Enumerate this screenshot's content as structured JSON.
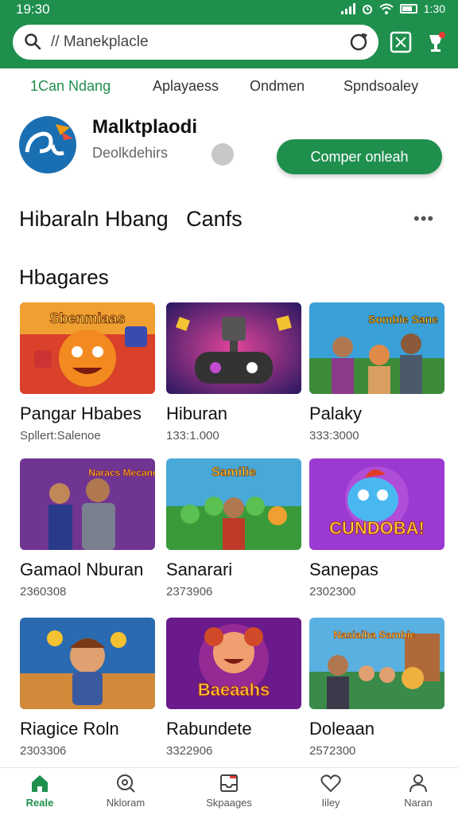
{
  "status_bar": {
    "time": "19:30",
    "right_text": "1:30"
  },
  "search": {
    "value": "// Manekplacle",
    "placeholder": ""
  },
  "tabs": [
    {
      "label": "1Can Ndang",
      "active": true
    },
    {
      "label": "Aplayaess",
      "active": false
    },
    {
      "label": "Ondmen",
      "active": false
    },
    {
      "label": "Spndsoaley",
      "active": false
    }
  ],
  "app": {
    "name": "Malktplaodi",
    "subtitle": "Deolkdehirs",
    "button_label": "Comper onleah"
  },
  "section_title": "Hibaraln Hbang   Canfs",
  "subsection_title": "Hbagares",
  "cards": [
    {
      "name": "Pangar Hbabes",
      "meta": "Spllert:Salenoe",
      "banner": "Sbenmiaas"
    },
    {
      "name": "Hiburan",
      "meta": "133:1.000",
      "banner": ""
    },
    {
      "name": "Palaky",
      "meta": "333:3000",
      "banner": "Sombie Sane"
    },
    {
      "name": "Gamaol Nburan",
      "meta": "2360308",
      "banner": "Naracs Mecaneaiis"
    },
    {
      "name": "Sanarari",
      "meta": "2373906",
      "banner": "Samilie"
    },
    {
      "name": "Sanepas",
      "meta": "2302300",
      "banner": "CUNDOBA!"
    },
    {
      "name": "Riagice Roln",
      "meta": "2303306",
      "banner": ""
    },
    {
      "name": "Rabundete",
      "meta": "3322906",
      "banner": "Baeaahs"
    },
    {
      "name": "Doleaan",
      "meta": "2572300",
      "banner": "Nasiaiba Sambie"
    }
  ],
  "bottom_nav": [
    {
      "label": "Reale",
      "icon": "home-icon",
      "active": true
    },
    {
      "label": "Nkloram",
      "icon": "search-doc-icon",
      "active": false
    },
    {
      "label": "Skpaages",
      "icon": "inbox-icon",
      "active": false
    },
    {
      "label": "Iiley",
      "icon": "heart-icon",
      "active": false
    },
    {
      "label": "Naran",
      "icon": "person-icon",
      "active": false
    }
  ],
  "colors": {
    "brand": "#1f8f4e",
    "header": "#1f8f4e",
    "logo": "#1a6fb2"
  }
}
